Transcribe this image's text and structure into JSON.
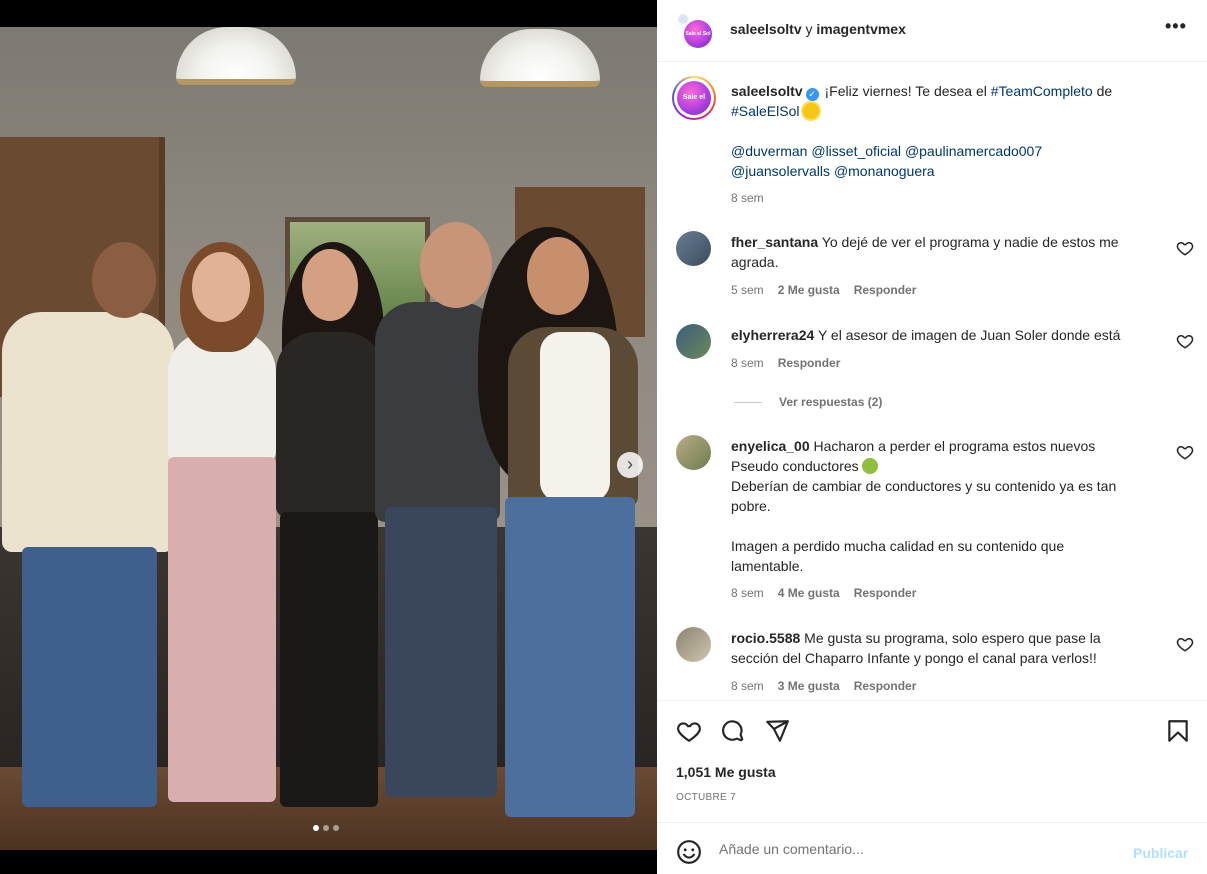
{
  "header": {
    "account": "saleelsoltv",
    "connector": "y",
    "collaborator": "imagentvmex",
    "more_icon": "more-horizontal-icon"
  },
  "caption": {
    "username": "saleelsoltv",
    "verified_icon": "verified-badge-icon",
    "text_before": "¡Feliz viernes! Te desea el",
    "hashtag1": "#TeamCompleto",
    "text_mid": "de",
    "hashtag2": "#SaleElSol",
    "mentions": [
      "@duverman",
      "@lisset_oficial",
      "@paulinamercado007",
      "@juansolervalls",
      "@monanoguera"
    ],
    "time": "8 sem"
  },
  "comments": [
    {
      "username": "fher_santana",
      "lines": [
        "Yo dejé de ver el programa y nadie de estos me",
        "agrada."
      ],
      "time": "5 sem",
      "likes": "2 Me gusta",
      "reply": "Responder"
    },
    {
      "username": "elyherrera24",
      "lines": [
        "Y el asesor de imagen de Juan Soler donde está"
      ],
      "time": "8 sem",
      "reply": "Responder",
      "view_replies": "Ver respuestas (2)"
    },
    {
      "username": "enyelica_00",
      "lines": [
        "Hacharon a perder el programa estos nuevos",
        "Pseudo conductores",
        "Deberían de cambiar de conductores y su contenido ya es tan",
        "pobre.",
        "",
        "Imagen a perdido mucha calidad en su contenido que",
        "lamentable."
      ],
      "time": "8 sem",
      "likes": "4 Me gusta",
      "reply": "Responder"
    },
    {
      "username": "rocio.5588",
      "lines": [
        "Me gusta su programa, solo espero que pase la",
        "sección del Chaparro Infante y pongo el canal para verlos!!"
      ],
      "time": "8 sem",
      "likes": "3 Me gusta",
      "reply": "Responder"
    }
  ],
  "actions": {
    "like_icon": "heart-icon",
    "comment_icon": "comment-icon",
    "share_icon": "paper-plane-icon",
    "save_icon": "bookmark-icon",
    "likes": "1,051 Me gusta",
    "date": "OCTUBRE 7"
  },
  "composer": {
    "placeholder": "Añade un comentario...",
    "publish": "Publicar"
  },
  "carousel": {
    "current": 1,
    "total": 3
  },
  "colors": {
    "link": "#00376b",
    "muted": "#737373",
    "publish_disabled": "#b2dffc",
    "verified": "#3897f0"
  }
}
